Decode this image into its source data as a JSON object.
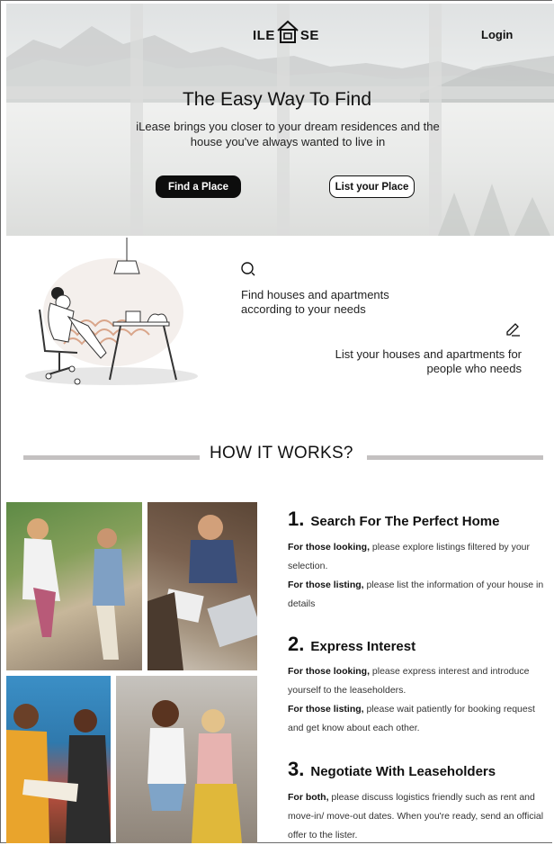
{
  "header": {
    "logo_left": "ILE",
    "logo_right": "SE",
    "login_label": "Login"
  },
  "hero": {
    "title": "The Easy Way To Find",
    "subtitle": "iLease brings you closer to your dream residences and the house you've always wanted to live in",
    "find_label": "Find a Place",
    "list_label": "List your Place"
  },
  "features": {
    "search_text": "Find houses and apartments according to your needs",
    "list_text": "List your houses and apartments for people who needs",
    "icons": [
      "search-icon",
      "pencil-icon"
    ]
  },
  "how_it_works": {
    "title": "HOW IT WORKS?",
    "steps": [
      {
        "num": "1.",
        "title": "Search For The Perfect Home",
        "p1_bold": "For those looking,",
        "p1_text": " please explore listings filtered by your selection.",
        "p2_bold": "For those listing,",
        "p2_text": " please list the information of your house in details"
      },
      {
        "num": "2.",
        "title": "Express Interest",
        "p1_bold": "For those looking,",
        "p1_text": " please express interest and introduce yourself to the leaseholders.",
        "p2_bold": "For those listing,",
        "p2_text": " please wait patiently for booking request and get know about each other."
      },
      {
        "num": "3.",
        "title": "Negotiate With Leaseholders",
        "p1_bold": "For both,",
        "p1_text": " please discuss logistics friendly such as rent and move-in/ move-out dates. When you're ready, send an official offer to the lister."
      }
    ]
  },
  "colors": {
    "primary_button": "#0d0d0d",
    "divider": "#c4c1c1"
  }
}
